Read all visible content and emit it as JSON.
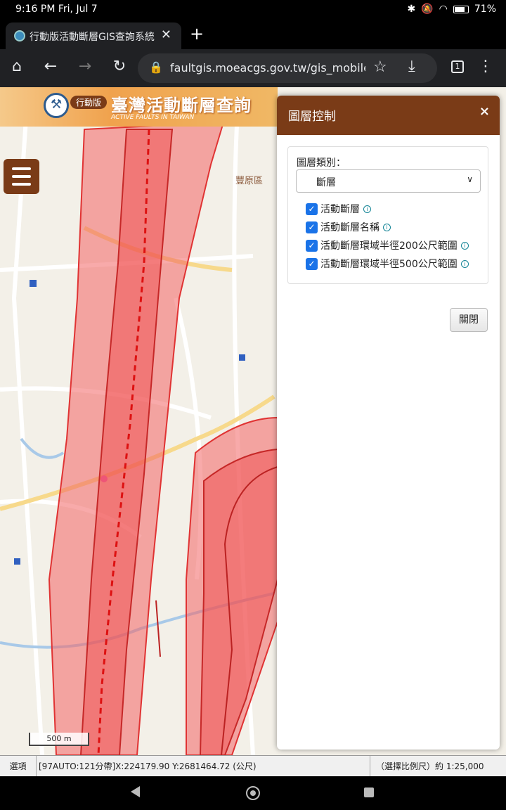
{
  "status": {
    "time": "9:16 PM Fri, Jul 7",
    "battery": "71%"
  },
  "browser": {
    "tab_title": "行動版活動斷層GIS查詢系統",
    "url": "faultgis.moeacgs.gov.tw/gis_mobile/",
    "tab_count": "1"
  },
  "banner": {
    "badge": "行動版",
    "title": "臺灣活動斷層查詢",
    "subtitle": "ACTIVE FAULTS IN TAIWAN"
  },
  "map": {
    "district_label": "豐原區",
    "scale_label": "500 m"
  },
  "panel": {
    "title": "圖層控制",
    "close_glyph": "×",
    "layer_type_label": "圖層類別：",
    "layer_type_value": "斷層",
    "layers": [
      {
        "label": "活動斷層",
        "checked": true
      },
      {
        "label": "活動斷層名稱",
        "checked": true
      },
      {
        "label": "活動斷層環域半徑200公尺範圍",
        "checked": true
      },
      {
        "label": "活動斷層環域半徑500公尺範圍",
        "checked": true
      }
    ],
    "close_button": "關閉"
  },
  "coord_bar": {
    "options": "選項",
    "coords": "[97AUTO:121分帶]X:224179.90 Y:2681464.72 (公尺)",
    "scale": "（選擇比例尺）約 1:25,000"
  }
}
